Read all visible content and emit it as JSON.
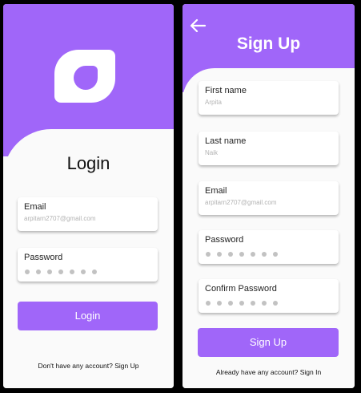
{
  "colors": {
    "accent": "#a066f9",
    "background": "#000000",
    "card": "#fafafa"
  },
  "login": {
    "title": "Login",
    "logo_icon": "leaf-logo-icon",
    "email": {
      "label": "Email",
      "value": "arpitarn2707@gmail.com"
    },
    "password": {
      "label": "Password",
      "masked_length": 7
    },
    "button_label": "Login",
    "footer_text": "Don't have any account? Sign Up"
  },
  "signup": {
    "back_icon": "back-arrow-icon",
    "title": "Sign Up",
    "first_name": {
      "label": "First name",
      "value": "Arpita"
    },
    "last_name": {
      "label": "Last name",
      "value": "Naik"
    },
    "email": {
      "label": "Email",
      "value": "arpitarn2707@gmail.com"
    },
    "password": {
      "label": "Password",
      "masked_length": 7
    },
    "confirm_password": {
      "label": "Confirm Password",
      "masked_length": 7
    },
    "button_label": "Sign Up",
    "footer_text": "Already have any account? Sign In"
  }
}
